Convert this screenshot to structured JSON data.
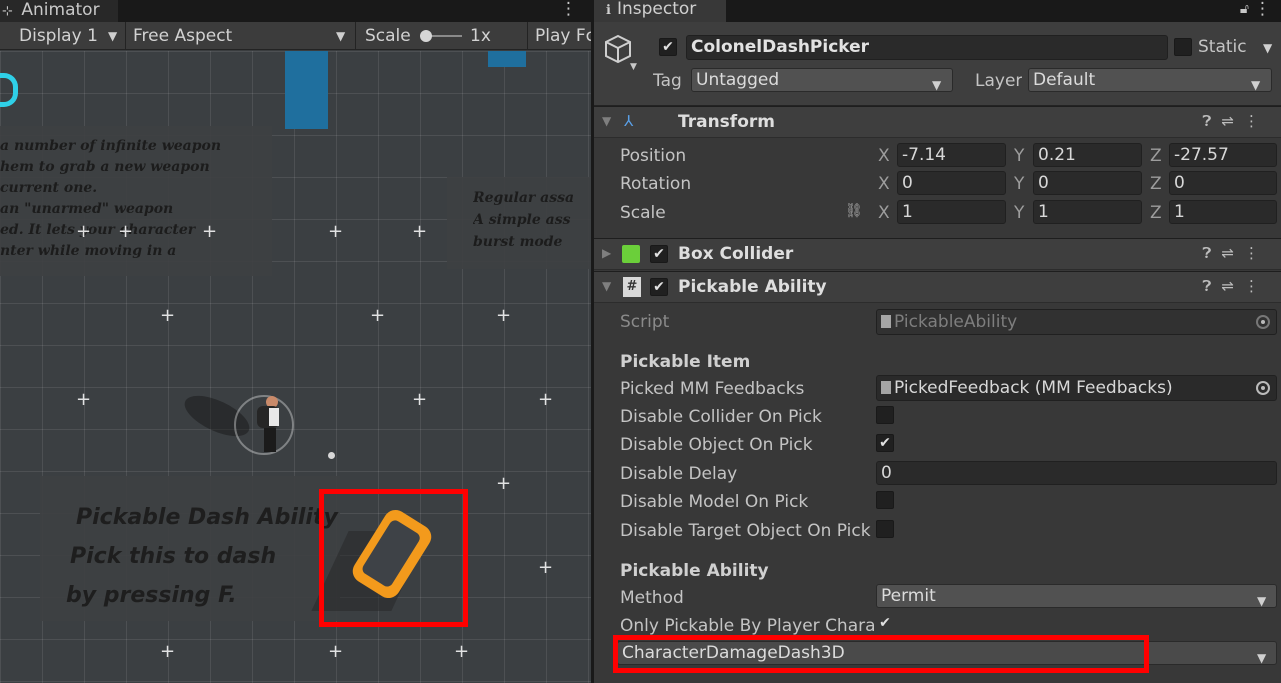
{
  "game": {
    "tab_title": "Animator",
    "toolbar": {
      "display": "Display 1",
      "aspect": "Free Aspect",
      "scale_label": "Scale",
      "scale_value": "1x",
      "play": "Play Fc"
    },
    "sign_top_left": [
      "a number of infinite weapon",
      "hem to grab a new weapon",
      "current one.",
      "an \"unarmed\" weapon",
      "ed. It lets your character",
      "nter while moving in a"
    ],
    "sign_top_right": [
      "Regular assa",
      "A simple ass",
      "burst mode"
    ],
    "sign_bottom": [
      "Pickable Dash Ability",
      "Pick this to dash",
      "by pressing F."
    ]
  },
  "inspector": {
    "tab_title": "Inspector",
    "object": {
      "name": "ColonelDashPicker",
      "active": true,
      "static_label": "Static",
      "tag_label": "Tag",
      "tag_value": "Untagged",
      "layer_label": "Layer",
      "layer_value": "Default"
    },
    "transform": {
      "title": "Transform",
      "rows": [
        {
          "label": "Position",
          "x": "-7.14",
          "y": "0.21",
          "z": "-27.57"
        },
        {
          "label": "Rotation",
          "x": "0",
          "y": "0",
          "z": "0"
        },
        {
          "label": "Scale",
          "x": "1",
          "y": "1",
          "z": "1"
        }
      ],
      "axis": {
        "x": "X",
        "y": "Y",
        "z": "Z"
      }
    },
    "box_collider": {
      "title": "Box Collider",
      "enabled": true
    },
    "pickable_ability": {
      "title": "Pickable Ability",
      "enabled": true,
      "script_label": "Script",
      "script_value": "PickableAbility",
      "section_item": "Pickable Item",
      "picked_feedbacks_label": "Picked MM Feedbacks",
      "picked_feedbacks_value": "PickedFeedback (MM Feedbacks)",
      "disable_collider_label": "Disable Collider On Pick",
      "disable_object_label": "Disable Object On Pick",
      "disable_delay_label": "Disable Delay",
      "disable_delay_value": "0",
      "disable_model_label": "Disable Model On Pick",
      "disable_target_label": "Disable Target Object On Pick",
      "section_ability": "Pickable Ability",
      "method_label": "Method",
      "method_value": "Permit",
      "only_player_label": "Only Pickable By Player Charac",
      "ability_value": "CharacterDamageDash3D"
    }
  },
  "colors": {
    "highlight": "#ff0000",
    "panel_bg": "#383838",
    "game_bg": "#3b3f42",
    "pickup_orange": "#f39a1c"
  }
}
